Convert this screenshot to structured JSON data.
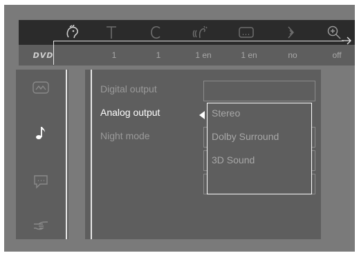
{
  "top_bar": {
    "icons": [
      "title-face-icon",
      "subtitle-t-icon",
      "chapter-c-icon",
      "audio-wave-icon",
      "subtitle-screen-icon",
      "angle-icon",
      "zoom-icon"
    ]
  },
  "status_bar": {
    "logo": "DVD",
    "values": [
      "1",
      "1",
      "1 en",
      "1 en",
      "no",
      "off"
    ]
  },
  "side_menu": {
    "icons": [
      "picture-icon",
      "music-note-icon",
      "speech-bubble-icon",
      "hand-pointer-icon"
    ]
  },
  "settings": {
    "items": [
      {
        "label": "Digital output"
      },
      {
        "label": "Analog output"
      },
      {
        "label": "Night mode"
      }
    ],
    "active_index": 1
  },
  "dropdown": {
    "options": [
      "Stereo",
      "Dolby Surround",
      "3D Sound"
    ]
  },
  "colors": {
    "screen_bg": "#7a7a7a",
    "panel_bg": "#5e5e5e",
    "topbar_bg": "#2b2b2b",
    "line": "#e8e8e8",
    "active_text": "#ffffff",
    "dim_text": "#9a9a9a"
  }
}
